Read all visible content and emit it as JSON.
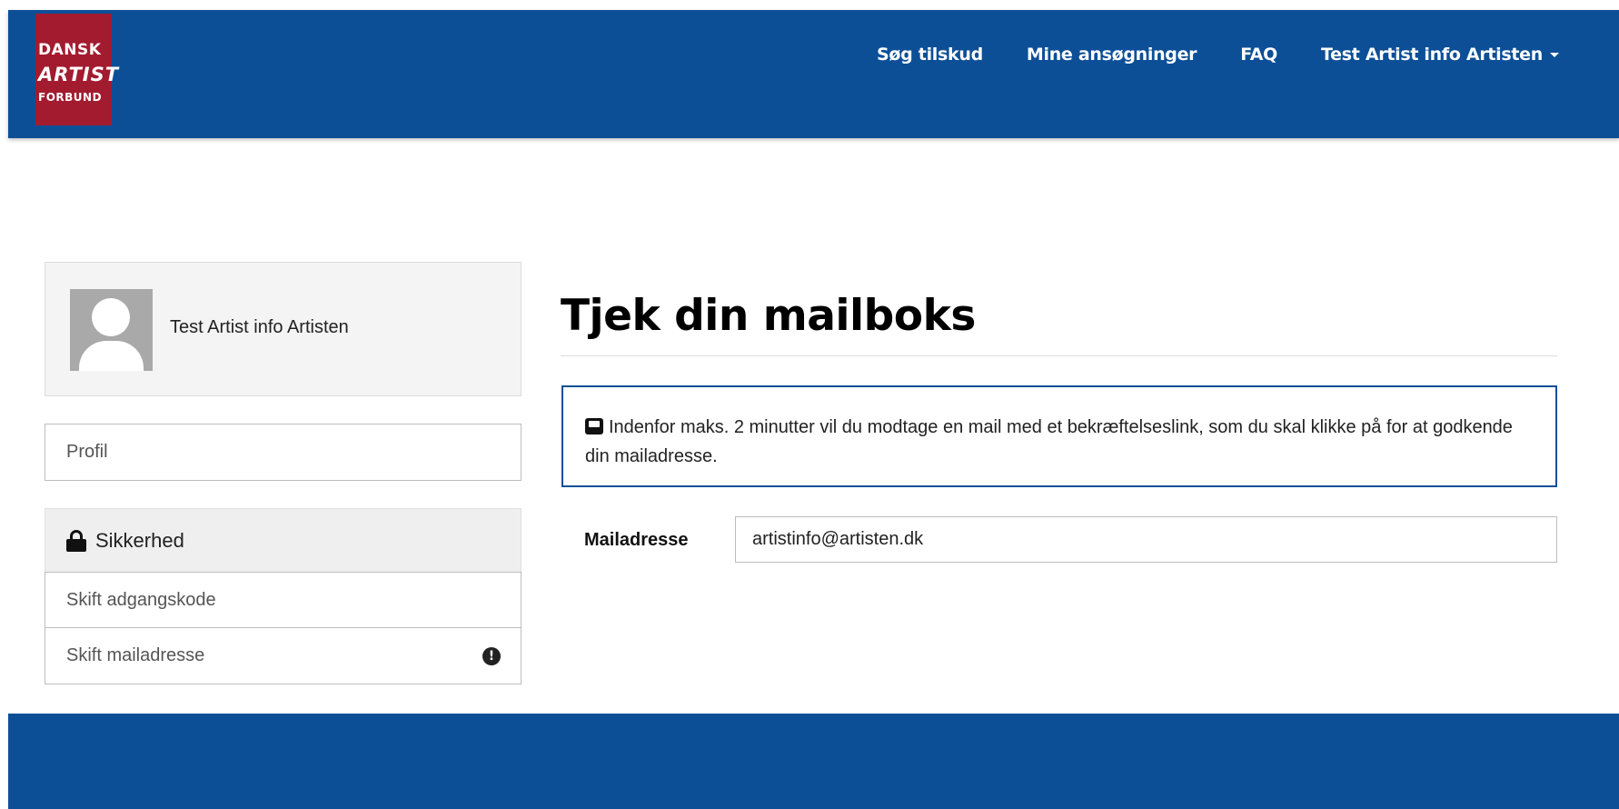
{
  "header": {
    "logo": {
      "line1": "DANSK",
      "line2": "ARTIST",
      "line3": "FORBUND"
    },
    "nav": {
      "items": [
        {
          "label": "Søg tilskud"
        },
        {
          "label": "Mine ansøgninger"
        },
        {
          "label": "FAQ"
        }
      ],
      "user_menu": "Test Artist info Artisten"
    }
  },
  "sidebar": {
    "profile_name": "Test Artist info Artisten",
    "profil_link": "Profil",
    "security": {
      "heading": "Sikkerhed",
      "items": [
        {
          "label": "Skift adgangskode"
        },
        {
          "label": "Skift mailadresse"
        }
      ]
    }
  },
  "main": {
    "title": "Tjek din mailboks",
    "info_text": "Indenfor maks. 2 minutter vil du modtage en mail med et bekræftelseslink, som du skal klikke på for at godkende din mailadresse.",
    "email_label": "Mailadresse",
    "email_value": "artistinfo@artisten.dk"
  },
  "colors": {
    "brand_blue": "#0d4f97",
    "logo_red": "#a31b2f"
  },
  "icons": {
    "lock": "lock-icon",
    "inbox": "inbox-icon",
    "warning": "exclamation-circle-icon",
    "caret": "caret-down-icon"
  }
}
